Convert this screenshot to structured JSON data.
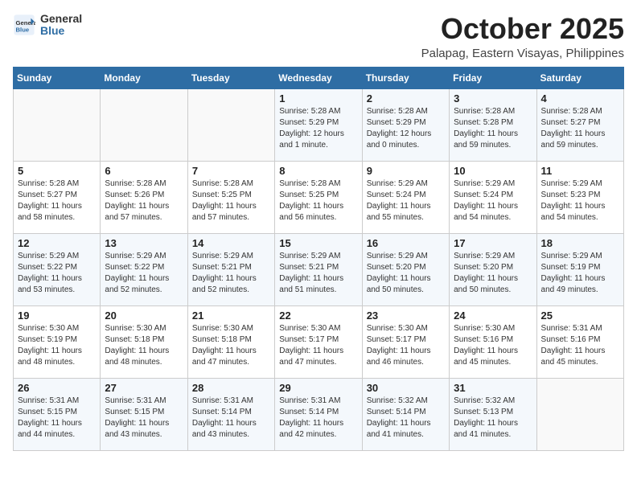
{
  "header": {
    "logo_line1": "General",
    "logo_line2": "Blue",
    "month": "October 2025",
    "location": "Palapag, Eastern Visayas, Philippines"
  },
  "weekdays": [
    "Sunday",
    "Monday",
    "Tuesday",
    "Wednesday",
    "Thursday",
    "Friday",
    "Saturday"
  ],
  "weeks": [
    [
      {
        "day": "",
        "info": ""
      },
      {
        "day": "",
        "info": ""
      },
      {
        "day": "",
        "info": ""
      },
      {
        "day": "1",
        "info": "Sunrise: 5:28 AM\nSunset: 5:29 PM\nDaylight: 12 hours\nand 1 minute."
      },
      {
        "day": "2",
        "info": "Sunrise: 5:28 AM\nSunset: 5:29 PM\nDaylight: 12 hours\nand 0 minutes."
      },
      {
        "day": "3",
        "info": "Sunrise: 5:28 AM\nSunset: 5:28 PM\nDaylight: 11 hours\nand 59 minutes."
      },
      {
        "day": "4",
        "info": "Sunrise: 5:28 AM\nSunset: 5:27 PM\nDaylight: 11 hours\nand 59 minutes."
      }
    ],
    [
      {
        "day": "5",
        "info": "Sunrise: 5:28 AM\nSunset: 5:27 PM\nDaylight: 11 hours\nand 58 minutes."
      },
      {
        "day": "6",
        "info": "Sunrise: 5:28 AM\nSunset: 5:26 PM\nDaylight: 11 hours\nand 57 minutes."
      },
      {
        "day": "7",
        "info": "Sunrise: 5:28 AM\nSunset: 5:25 PM\nDaylight: 11 hours\nand 57 minutes."
      },
      {
        "day": "8",
        "info": "Sunrise: 5:28 AM\nSunset: 5:25 PM\nDaylight: 11 hours\nand 56 minutes."
      },
      {
        "day": "9",
        "info": "Sunrise: 5:29 AM\nSunset: 5:24 PM\nDaylight: 11 hours\nand 55 minutes."
      },
      {
        "day": "10",
        "info": "Sunrise: 5:29 AM\nSunset: 5:24 PM\nDaylight: 11 hours\nand 54 minutes."
      },
      {
        "day": "11",
        "info": "Sunrise: 5:29 AM\nSunset: 5:23 PM\nDaylight: 11 hours\nand 54 minutes."
      }
    ],
    [
      {
        "day": "12",
        "info": "Sunrise: 5:29 AM\nSunset: 5:22 PM\nDaylight: 11 hours\nand 53 minutes."
      },
      {
        "day": "13",
        "info": "Sunrise: 5:29 AM\nSunset: 5:22 PM\nDaylight: 11 hours\nand 52 minutes."
      },
      {
        "day": "14",
        "info": "Sunrise: 5:29 AM\nSunset: 5:21 PM\nDaylight: 11 hours\nand 52 minutes."
      },
      {
        "day": "15",
        "info": "Sunrise: 5:29 AM\nSunset: 5:21 PM\nDaylight: 11 hours\nand 51 minutes."
      },
      {
        "day": "16",
        "info": "Sunrise: 5:29 AM\nSunset: 5:20 PM\nDaylight: 11 hours\nand 50 minutes."
      },
      {
        "day": "17",
        "info": "Sunrise: 5:29 AM\nSunset: 5:20 PM\nDaylight: 11 hours\nand 50 minutes."
      },
      {
        "day": "18",
        "info": "Sunrise: 5:29 AM\nSunset: 5:19 PM\nDaylight: 11 hours\nand 49 minutes."
      }
    ],
    [
      {
        "day": "19",
        "info": "Sunrise: 5:30 AM\nSunset: 5:19 PM\nDaylight: 11 hours\nand 48 minutes."
      },
      {
        "day": "20",
        "info": "Sunrise: 5:30 AM\nSunset: 5:18 PM\nDaylight: 11 hours\nand 48 minutes."
      },
      {
        "day": "21",
        "info": "Sunrise: 5:30 AM\nSunset: 5:18 PM\nDaylight: 11 hours\nand 47 minutes."
      },
      {
        "day": "22",
        "info": "Sunrise: 5:30 AM\nSunset: 5:17 PM\nDaylight: 11 hours\nand 47 minutes."
      },
      {
        "day": "23",
        "info": "Sunrise: 5:30 AM\nSunset: 5:17 PM\nDaylight: 11 hours\nand 46 minutes."
      },
      {
        "day": "24",
        "info": "Sunrise: 5:30 AM\nSunset: 5:16 PM\nDaylight: 11 hours\nand 45 minutes."
      },
      {
        "day": "25",
        "info": "Sunrise: 5:31 AM\nSunset: 5:16 PM\nDaylight: 11 hours\nand 45 minutes."
      }
    ],
    [
      {
        "day": "26",
        "info": "Sunrise: 5:31 AM\nSunset: 5:15 PM\nDaylight: 11 hours\nand 44 minutes."
      },
      {
        "day": "27",
        "info": "Sunrise: 5:31 AM\nSunset: 5:15 PM\nDaylight: 11 hours\nand 43 minutes."
      },
      {
        "day": "28",
        "info": "Sunrise: 5:31 AM\nSunset: 5:14 PM\nDaylight: 11 hours\nand 43 minutes."
      },
      {
        "day": "29",
        "info": "Sunrise: 5:31 AM\nSunset: 5:14 PM\nDaylight: 11 hours\nand 42 minutes."
      },
      {
        "day": "30",
        "info": "Sunrise: 5:32 AM\nSunset: 5:14 PM\nDaylight: 11 hours\nand 41 minutes."
      },
      {
        "day": "31",
        "info": "Sunrise: 5:32 AM\nSunset: 5:13 PM\nDaylight: 11 hours\nand 41 minutes."
      },
      {
        "day": "",
        "info": ""
      }
    ]
  ]
}
